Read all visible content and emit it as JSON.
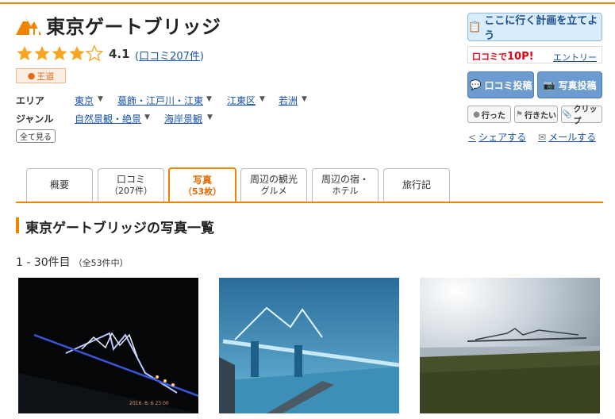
{
  "spot": {
    "title": "東京ゲートブリッジ",
    "score": "4.1",
    "review_link": "口コミ207件",
    "badge": "王道",
    "rating": 4.1
  },
  "details": {
    "area_label": "エリア",
    "area_items": [
      "東京",
      "葛飾・江戸川・江東",
      "江東区",
      "若洲"
    ],
    "genre_label": "ジャンル",
    "genre_items": [
      "自然景観・絶景",
      "海岸景観"
    ],
    "show_all": "全て見る"
  },
  "actions": {
    "plan": "ここに行く計画を立てよう",
    "promo_prefix": "口コミで",
    "promo_points": "10P!",
    "promo_entry": "エントリー",
    "post_review": "口コミ投稿",
    "post_photo": "写真投稿",
    "went": "行った",
    "want": "行きたい",
    "clip": "クリップ",
    "share": "シェアする",
    "mail": "メールする"
  },
  "tabs": [
    {
      "label": "概要",
      "sub": ""
    },
    {
      "label": "口コミ",
      "sub": "（207件）"
    },
    {
      "label": "写真",
      "sub": "（53枚）"
    },
    {
      "label": "周辺の観光",
      "sub": "グルメ"
    },
    {
      "label": "周辺の宿・",
      "sub": "ホテル"
    },
    {
      "label": "旅行記",
      "sub": ""
    }
  ],
  "active_tab": "写真",
  "section": {
    "title": "東京ゲートブリッジの写真一覧",
    "range": "1 - 30件目",
    "total": "（全53件中）"
  },
  "photos": [
    {
      "alt": "night-bridge-photo",
      "stamp": "2016. 8. 6  23:00"
    },
    {
      "alt": "blue-bridge-photo",
      "stamp": ""
    },
    {
      "alt": "daytime-bridge-photo",
      "stamp": ""
    }
  ],
  "colors": {
    "accent": "#f08300",
    "link": "#1a55a8",
    "promo": "#e60012"
  }
}
